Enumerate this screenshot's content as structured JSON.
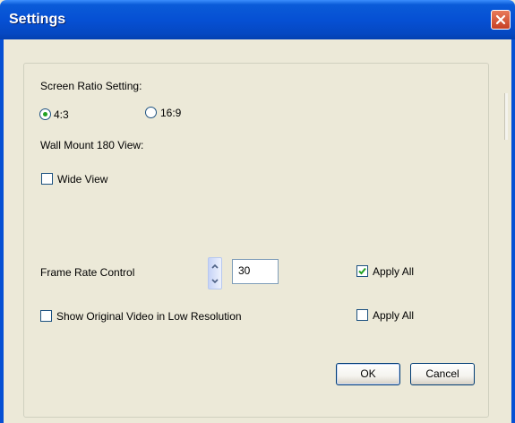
{
  "window": {
    "title": "Settings"
  },
  "screen_ratio": {
    "label": "Screen Ratio Setting:",
    "options": [
      {
        "label": "4:3",
        "selected": true
      },
      {
        "label": "16:9",
        "selected": false
      }
    ]
  },
  "wall_mount": {
    "label": "Wall Mount 180 View:",
    "wide_view": {
      "label": "Wide View",
      "checked": false
    }
  },
  "frame_rate": {
    "label": "Frame Rate Control",
    "value": "30",
    "apply_all": {
      "label": "Apply All",
      "checked": true
    }
  },
  "low_res": {
    "label": "Show Original Video in Low Resolution",
    "checked": false,
    "apply_all": {
      "label": "Apply All",
      "checked": false
    }
  },
  "buttons": {
    "ok": "OK",
    "cancel": "Cancel"
  },
  "colors": {
    "titlebar": "#0650d4",
    "close": "#c64025",
    "face": "#ece9d8",
    "radio_dot": "#21a121"
  }
}
